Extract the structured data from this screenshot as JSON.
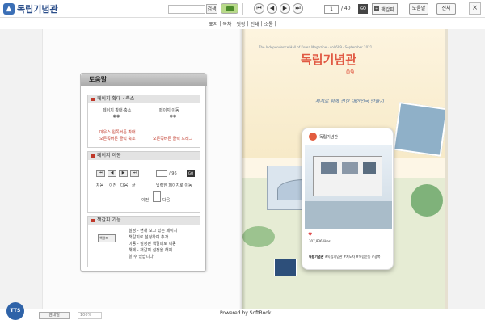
{
  "app": {
    "logo_text": "독립기념관",
    "logo_icon": "building-icon"
  },
  "toolbar": {
    "search_placeholder": "",
    "search_label": "검색",
    "book_icon": "book-icon",
    "nav_first": "⏮",
    "nav_prev": "◀",
    "nav_next": "▶",
    "nav_last": "⏭",
    "current_page": "1",
    "total_pages": "/ 40",
    "go_label": "GO",
    "bookmark_label": "책갈피",
    "bookmark_plus": "+",
    "help_label": "도움말",
    "full_label": "전체"
  },
  "subnav": {
    "items": [
      "표지",
      "|",
      "목차",
      "|",
      "뒷장",
      "|",
      "인쇄",
      "|",
      "소통",
      "|"
    ]
  },
  "help_panel": {
    "title": "도움말",
    "zoom_section": {
      "header": "페이지 확대 · 축소",
      "zoom_text": "페이지 확대·축소",
      "move_text": "페이지 이동",
      "left_hint_1": "마우스 왼쪽버튼 확대",
      "left_hint_2": "오른쪽버튼 클릭 축소",
      "right_hint": "오른쪽버튼 클릭 드래그"
    },
    "move_section": {
      "header": "페이지 이동",
      "page_value": "1",
      "page_total": "/ 96",
      "go_label": "GO",
      "labels": [
        "처음",
        "이전",
        "다음",
        "끝",
        "입력한 페이지로 이동"
      ],
      "prev_label": "이전",
      "next_label": "다음"
    },
    "bookmark_section": {
      "header": "책갈피 기능",
      "button_label": "책갈피",
      "lines": [
        "설정 - 현재 보고 있는 페이지",
        "책갈피로 설정하여 추가",
        "이동 - 설정된 책갈피로 이동",
        "해제 - 책갈피 설정을 해제",
        "할 수 있습니다"
      ]
    }
  },
  "magazine": {
    "subtitle": "The Independence Hall of Korea Magazine · vol 699 · September 2021",
    "title": "독립기념관",
    "issue": "09",
    "slogan": "세계로 함께 선한 대한민국 만들기",
    "post_account": "독립기념관",
    "post_likes": "307,836 likes",
    "post_caption_user": "독립기념관",
    "post_caption": "#독립기념관 #지도자 #독립운동 #광복"
  },
  "footer": {
    "tts_label": "TTS",
    "thumbs_label": "썸네일",
    "zoom_value": "100%",
    "powered": "Powered by SoftBook"
  }
}
